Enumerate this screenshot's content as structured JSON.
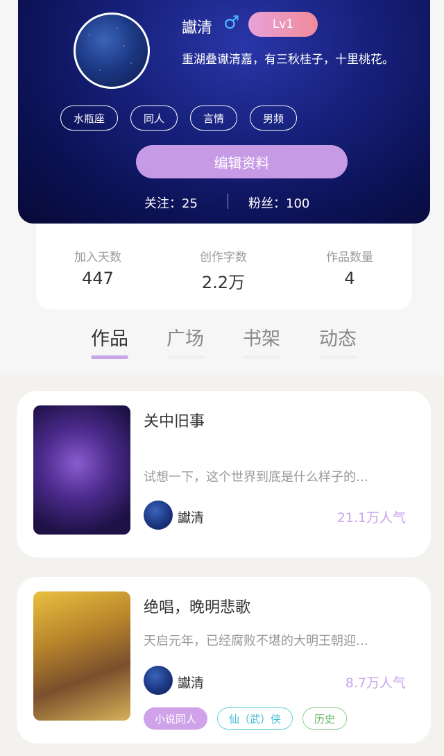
{
  "profile": {
    "username": "讞清",
    "gender_icon": "male-icon",
    "level": "Lv1",
    "bio": "重湖叠谳清嘉，有三秋桂子，十里桃花。",
    "tags": [
      "水瓶座",
      "同人",
      "言情",
      "男频"
    ],
    "edit_button": "编辑资料",
    "following_label": "关注：25",
    "followers_label": "粉丝：100"
  },
  "stats": [
    {
      "label": "加入天数",
      "value": "447"
    },
    {
      "label": "创作字数",
      "value": "2.2万"
    },
    {
      "label": "作品数量",
      "value": "4"
    }
  ],
  "tabs": [
    "作品",
    "广场",
    "书架",
    "动态"
  ],
  "active_tab": "作品",
  "works": [
    {
      "title": "关中旧事",
      "desc": "试想一下，这个世界到底是什么样子的…",
      "author": "讞清",
      "popularity": "21.1万人气",
      "tags": []
    },
    {
      "title": "绝唱，晚明悲歌",
      "desc": "天启元年，已经腐败不堪的大明王朝迎…",
      "author": "讞清",
      "popularity": "8.7万人气",
      "tags": [
        "小说同人",
        "仙（武）侠",
        "历史"
      ]
    }
  ],
  "colors": {
    "accent": "#c79ae6",
    "header_bg": "#0b1050",
    "popularity": "#c9a6ea"
  }
}
